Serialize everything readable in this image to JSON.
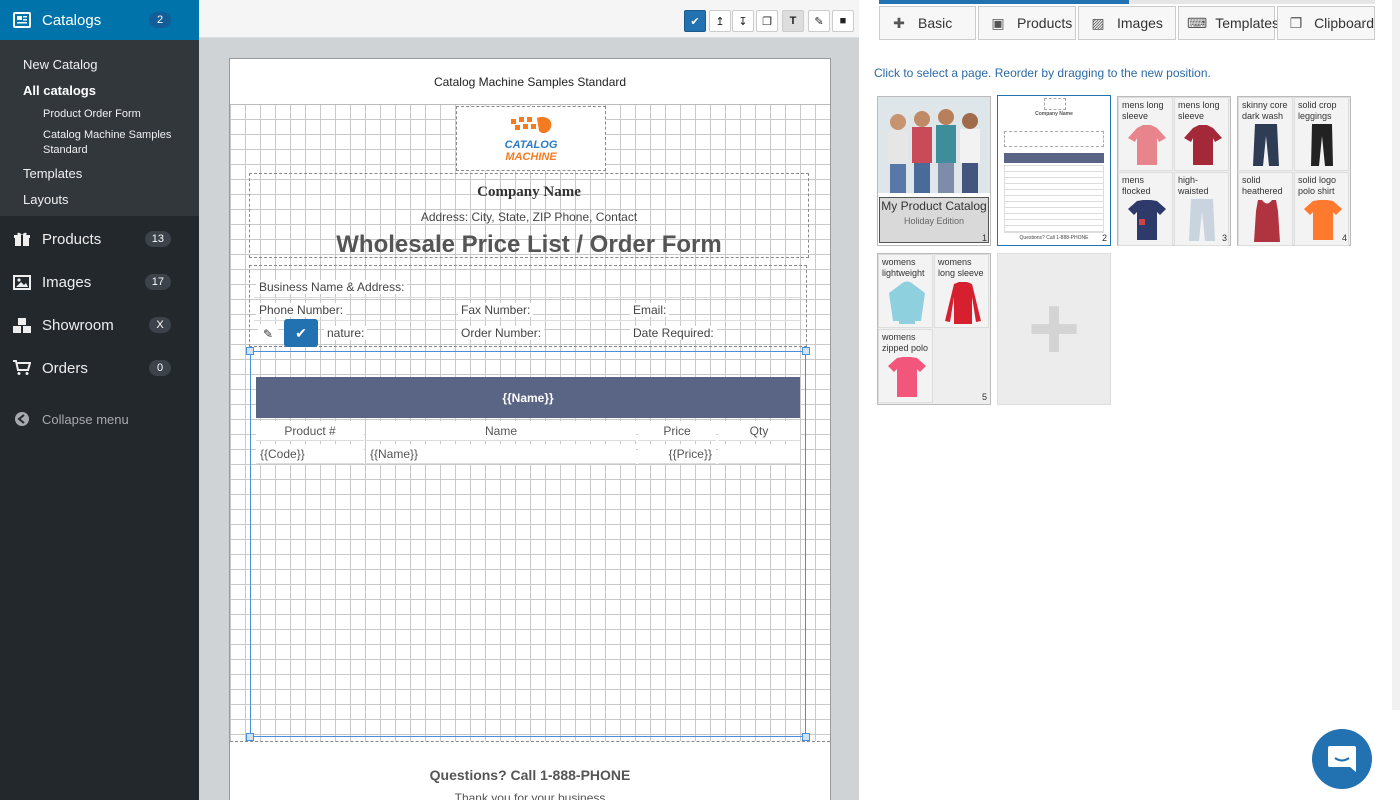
{
  "sidebar": {
    "catalogs": {
      "label": "Catalogs",
      "badge": "2"
    },
    "sub": {
      "new_catalog": "New Catalog",
      "all_catalogs": "All catalogs",
      "product_order_form": "Product Order Form",
      "catalog_machine_samples": "Catalog Machine Samples Standard",
      "templates": "Templates",
      "layouts": "Layouts"
    },
    "products": {
      "label": "Products",
      "badge": "13"
    },
    "images": {
      "label": "Images",
      "badge": "17"
    },
    "showroom": {
      "label": "Showroom",
      "badge": "X"
    },
    "orders": {
      "label": "Orders",
      "badge": "0"
    },
    "collapse": "Collapse menu"
  },
  "canvas": {
    "page_header": "Catalog Machine Samples Standard",
    "logo": {
      "line1": "CATALOG",
      "line2": "MACHINE"
    },
    "company_name": "Company Name",
    "address": "Address: City, State, ZIP Phone, Contact",
    "title": "Wholesale Price List / Order Form",
    "fields": {
      "business": "Business Name & Address:",
      "phone": "Phone Number:",
      "fax": "Fax Number:",
      "email": "Email:",
      "signature": "nature:",
      "order_number": "Order Number:",
      "date_required": "Date Required:"
    },
    "table": {
      "header": "{{Name}}",
      "columns": [
        "Product #",
        "Name",
        "Price",
        "Qty"
      ],
      "row": [
        "{{Code}}",
        "{{Name}}",
        "{{Price}}",
        ""
      ]
    },
    "footer": {
      "title": "Questions? Call 1-888-PHONE",
      "subtitle": "Thank you for your business"
    }
  },
  "right": {
    "tabs": [
      "Basic",
      "Products",
      "Images",
      "Templates",
      "Clipboard"
    ],
    "hint": "Click to select a page. Reorder by dragging to the new position.",
    "page1": {
      "title": "My Product Catalog",
      "subtitle": "Holiday Edition",
      "num": "1"
    },
    "page2": {
      "num": "2",
      "mini_title": "Company Name",
      "mini_footer": "Questions? Call 1-888-PHONE"
    },
    "page3": {
      "items": [
        "mens long sleeve",
        "mens long sleeve",
        "mens flocked",
        "high-waisted"
      ],
      "num": "3"
    },
    "page4": {
      "items": [
        "skinny core dark wash",
        "solid crop leggings",
        "solid heathered",
        "solid logo polo shirt"
      ],
      "num": "4"
    },
    "page5": {
      "items": [
        "womens lightweight",
        "womens long sleeve",
        "womens zipped polo"
      ],
      "num": "5"
    }
  },
  "colors": {
    "accent": "#2271b1",
    "sidebar": "#23282d",
    "table_header": "#5a6484"
  }
}
